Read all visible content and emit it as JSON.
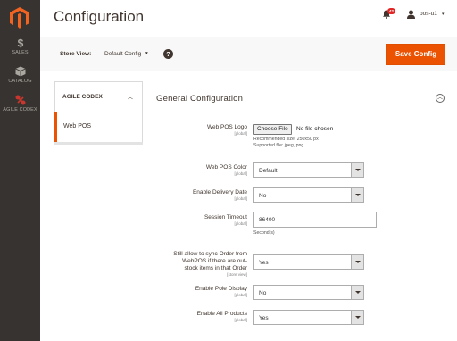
{
  "sidebar": {
    "logo_icon": "magento-logo-icon",
    "items": [
      {
        "label": "SALES",
        "icon": "dollar-icon"
      },
      {
        "label": "CATALOG",
        "icon": "cube-icon"
      },
      {
        "label": "AGILE CODEX",
        "icon": "agile-codex-icon"
      }
    ]
  },
  "header": {
    "title": "Configuration",
    "notifications_count": "42",
    "user_name": "pos-u1",
    "user_caret": "▾"
  },
  "store_view": {
    "label": "Store View:",
    "value": "Default Config",
    "caret": "▾",
    "help": "?",
    "save_label": "Save Config"
  },
  "tabs": {
    "group_title": "AGILE CODEX",
    "group_caret": "︿",
    "items": [
      {
        "label": "Web POS",
        "active": true
      }
    ]
  },
  "section": {
    "title": "General Configuration",
    "toggle": "︿"
  },
  "fields": {
    "logo": {
      "label": "Web POS Logo",
      "scope": "[global]",
      "button": "Choose File",
      "no_file": "No file chosen",
      "note1": "Recommended size: 250x50 px",
      "note2": "Supported file: jpeg, png"
    },
    "color": {
      "label": "Web POS Color",
      "scope": "[global]",
      "value": "Default"
    },
    "delivery": {
      "label": "Enable Delivery Date",
      "scope": "[global]",
      "value": "No"
    },
    "timeout": {
      "label": "Session Timeout",
      "scope": "[global]",
      "value": "86400",
      "note": "Second(s)"
    },
    "sync": {
      "label1": "Still allow to sync Order from",
      "label2": "WebPOS if there are out-",
      "label3": "stock items in that Order",
      "scope": "[store view]",
      "value": "Yes"
    },
    "pole": {
      "label": "Enable Pole Display",
      "scope": "[global]",
      "value": "No"
    },
    "all_products": {
      "label": "Enable All Products",
      "scope": "[global]",
      "value": "Yes"
    }
  },
  "colors": {
    "accent": "#eb5202",
    "sidebar_bg": "#373330",
    "badge": "#e22626"
  }
}
